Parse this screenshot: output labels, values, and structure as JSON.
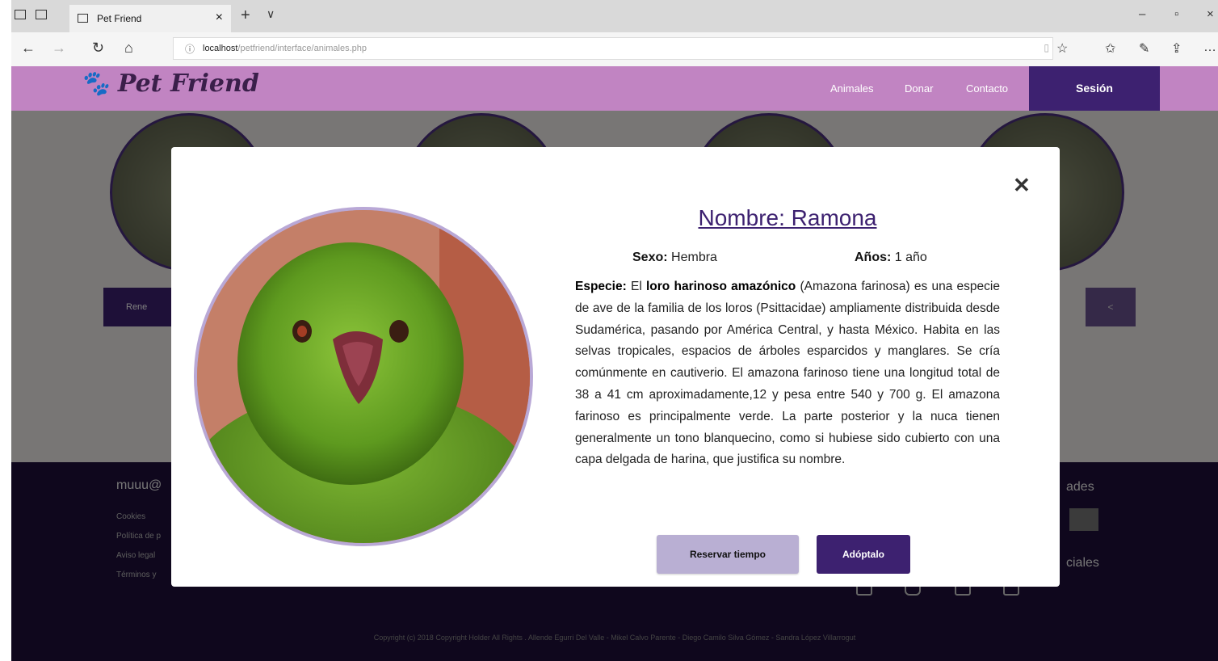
{
  "browser": {
    "tab_title": "Pet Friend",
    "tab_close": "×",
    "new_tab": "+",
    "tab_menu": "∨",
    "url_host": "localhost",
    "url_path": "/petfriend/interface/animales.php",
    "win_min": "–",
    "win_max": "▫",
    "win_close": "×"
  },
  "header": {
    "logo": "Pet Friend",
    "nav": [
      "Animales",
      "Donar",
      "Contacto"
    ],
    "session": "Sesión"
  },
  "background": {
    "pet_button_first": "Rene",
    "share_glyph": "<",
    "footer": {
      "title_left": "muuu@",
      "links": [
        "Cookies",
        "Política de p",
        "Aviso legal",
        "Términos y"
      ],
      "title_right_1": "ades",
      "title_right_2": "ciales",
      "copyright": "Copyright (c) 2018 Copyright Holder All Rights . Allende Egurri Del Valle - Mikel Calvo Parente - Diego Camilo Silva Gómez - Sandra López Villarrogut"
    }
  },
  "modal": {
    "close": "✕",
    "title": "Nombre: Ramona",
    "sexo_label": "Sexo:",
    "sexo_value": "Hembra",
    "anos_label": "Años:",
    "anos_value": "1 año",
    "description": {
      "label": "Especie:",
      "text1": "El",
      "bold": "loro harinoso amazónico",
      "text2": "(Amazona farinosa) es una especie de ave de la familia de los loros (Psittacidae) ampliamente distribuida desde Sudamérica, pasando por América Central, y hasta México. Habita en las selvas tropicales, espacios de árboles esparcidos y manglares. Se cría comúnmente en cautiverio. El amazona farinoso tiene una longitud total de 38 a 41 cm aproximadamente,12 y pesa entre 540 y 700 g. El amazona farinoso es principalmente verde. La parte posterior y la nuca tienen generalmente un tono blanquecino, como si hubiese sido cubierto con una capa delgada de harina, que justifica su nombre."
    },
    "btn_reserve": "Reservar tiempo",
    "btn_adopt": "Adóptalo"
  },
  "colors": {
    "header_bg": "#c184c2",
    "accent": "#3d2170",
    "footer_bg": "#1e0f3a",
    "reserve_bg": "#b9afd3"
  }
}
